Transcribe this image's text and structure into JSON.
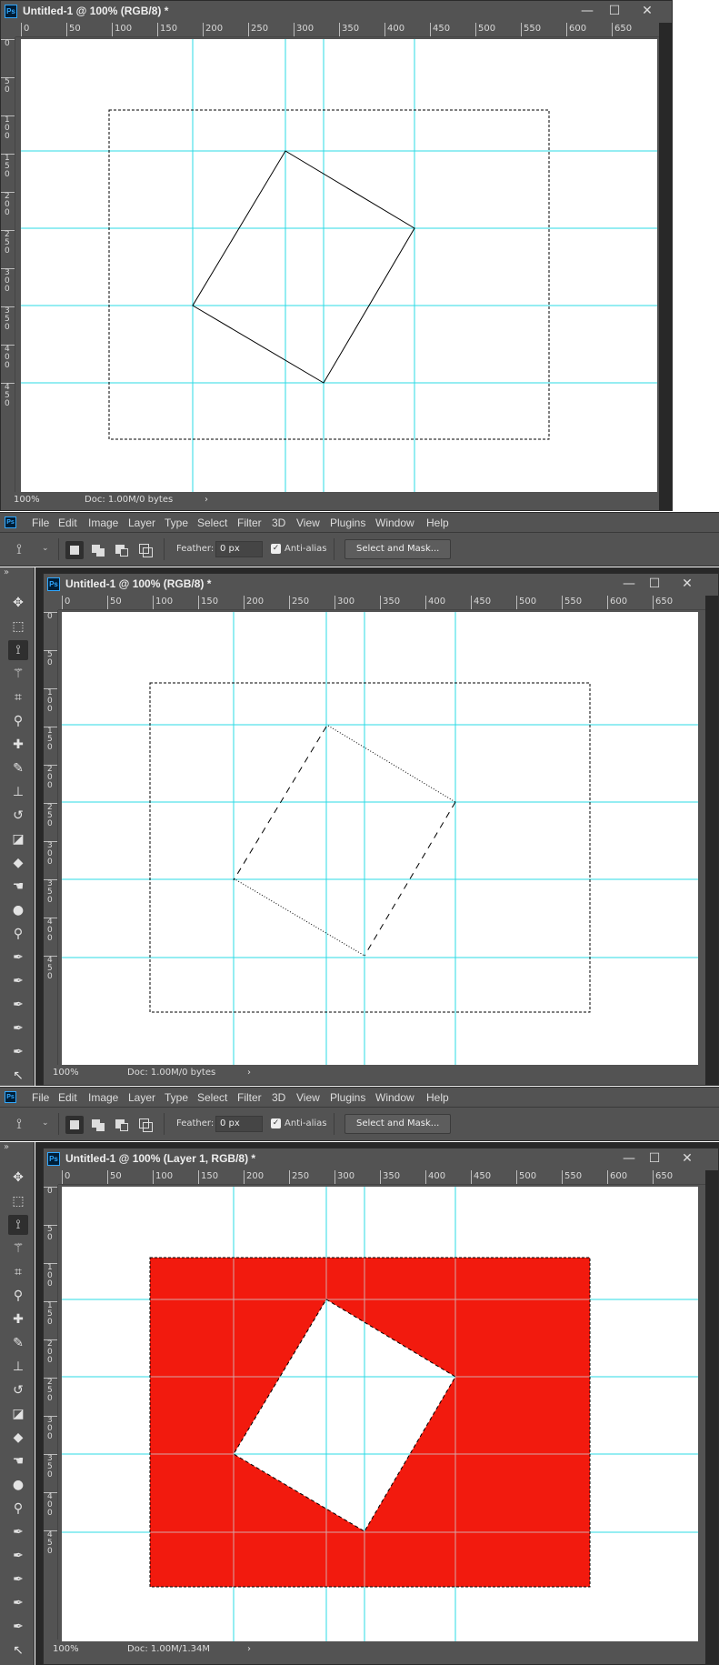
{
  "windows": {
    "w1": {
      "title": "Untitled-1 @ 100% (RGB/8) *",
      "zoom": "100%",
      "doc": "Doc: 1.00M/0 bytes"
    },
    "w2": {
      "title": "Untitled-1 @ 100% (RGB/8) *",
      "zoom": "100%",
      "doc": "Doc: 1.00M/0 bytes"
    },
    "w3": {
      "title": "Untitled-1 @ 100% (Layer 1, RGB/8) *",
      "zoom": "100%",
      "doc": "Doc: 1.00M/1.34M"
    }
  },
  "app_icon": "Ps",
  "window_controls": {
    "minimize": "—",
    "maximize": "☐",
    "close": "✕"
  },
  "menu": [
    "File",
    "Edit",
    "Image",
    "Layer",
    "Type",
    "Select",
    "Filter",
    "3D",
    "View",
    "Plugins",
    "Window",
    "Help"
  ],
  "options_bar": {
    "feather_label": "Feather:",
    "feather_value": "0 px",
    "antialias_label": "Anti-alias",
    "antialias_checked": true,
    "select_mask_label": "Select and Mask..."
  },
  "ruler_h": [
    "0",
    "50",
    "100",
    "150",
    "200",
    "250",
    "300",
    "350",
    "400",
    "450",
    "500",
    "550",
    "600",
    "650"
  ],
  "ruler_v": [
    "0",
    "5\n0",
    "1\n0\n0",
    "1\n5\n0",
    "2\n0\n0",
    "2\n5\n0",
    "3\n0\n0",
    "3\n5\n0",
    "4\n0\n0",
    "4\n5\n0"
  ],
  "tools": [
    "move-tool",
    "marquee-tool",
    "polygonal-lasso-tool",
    "magic-wand-tool",
    "crop-tool",
    "eyedropper-tool",
    "healing-brush-tool",
    "brush-tool",
    "clone-stamp-tool",
    "history-brush-tool",
    "eraser-tool",
    "paint-bucket-tool",
    "smudge-tool",
    "blur-tool",
    "dodge-tool",
    "pen-tool",
    "freeform-pen-tool",
    "curvature-pen-tool",
    "add-anchor-tool",
    "delete-anchor-tool",
    "path-selection-tool"
  ],
  "collapse_label": "»",
  "colors": {
    "guide": "#2bdbe6",
    "fill": "#f21a0e",
    "chrome": "#535353"
  }
}
